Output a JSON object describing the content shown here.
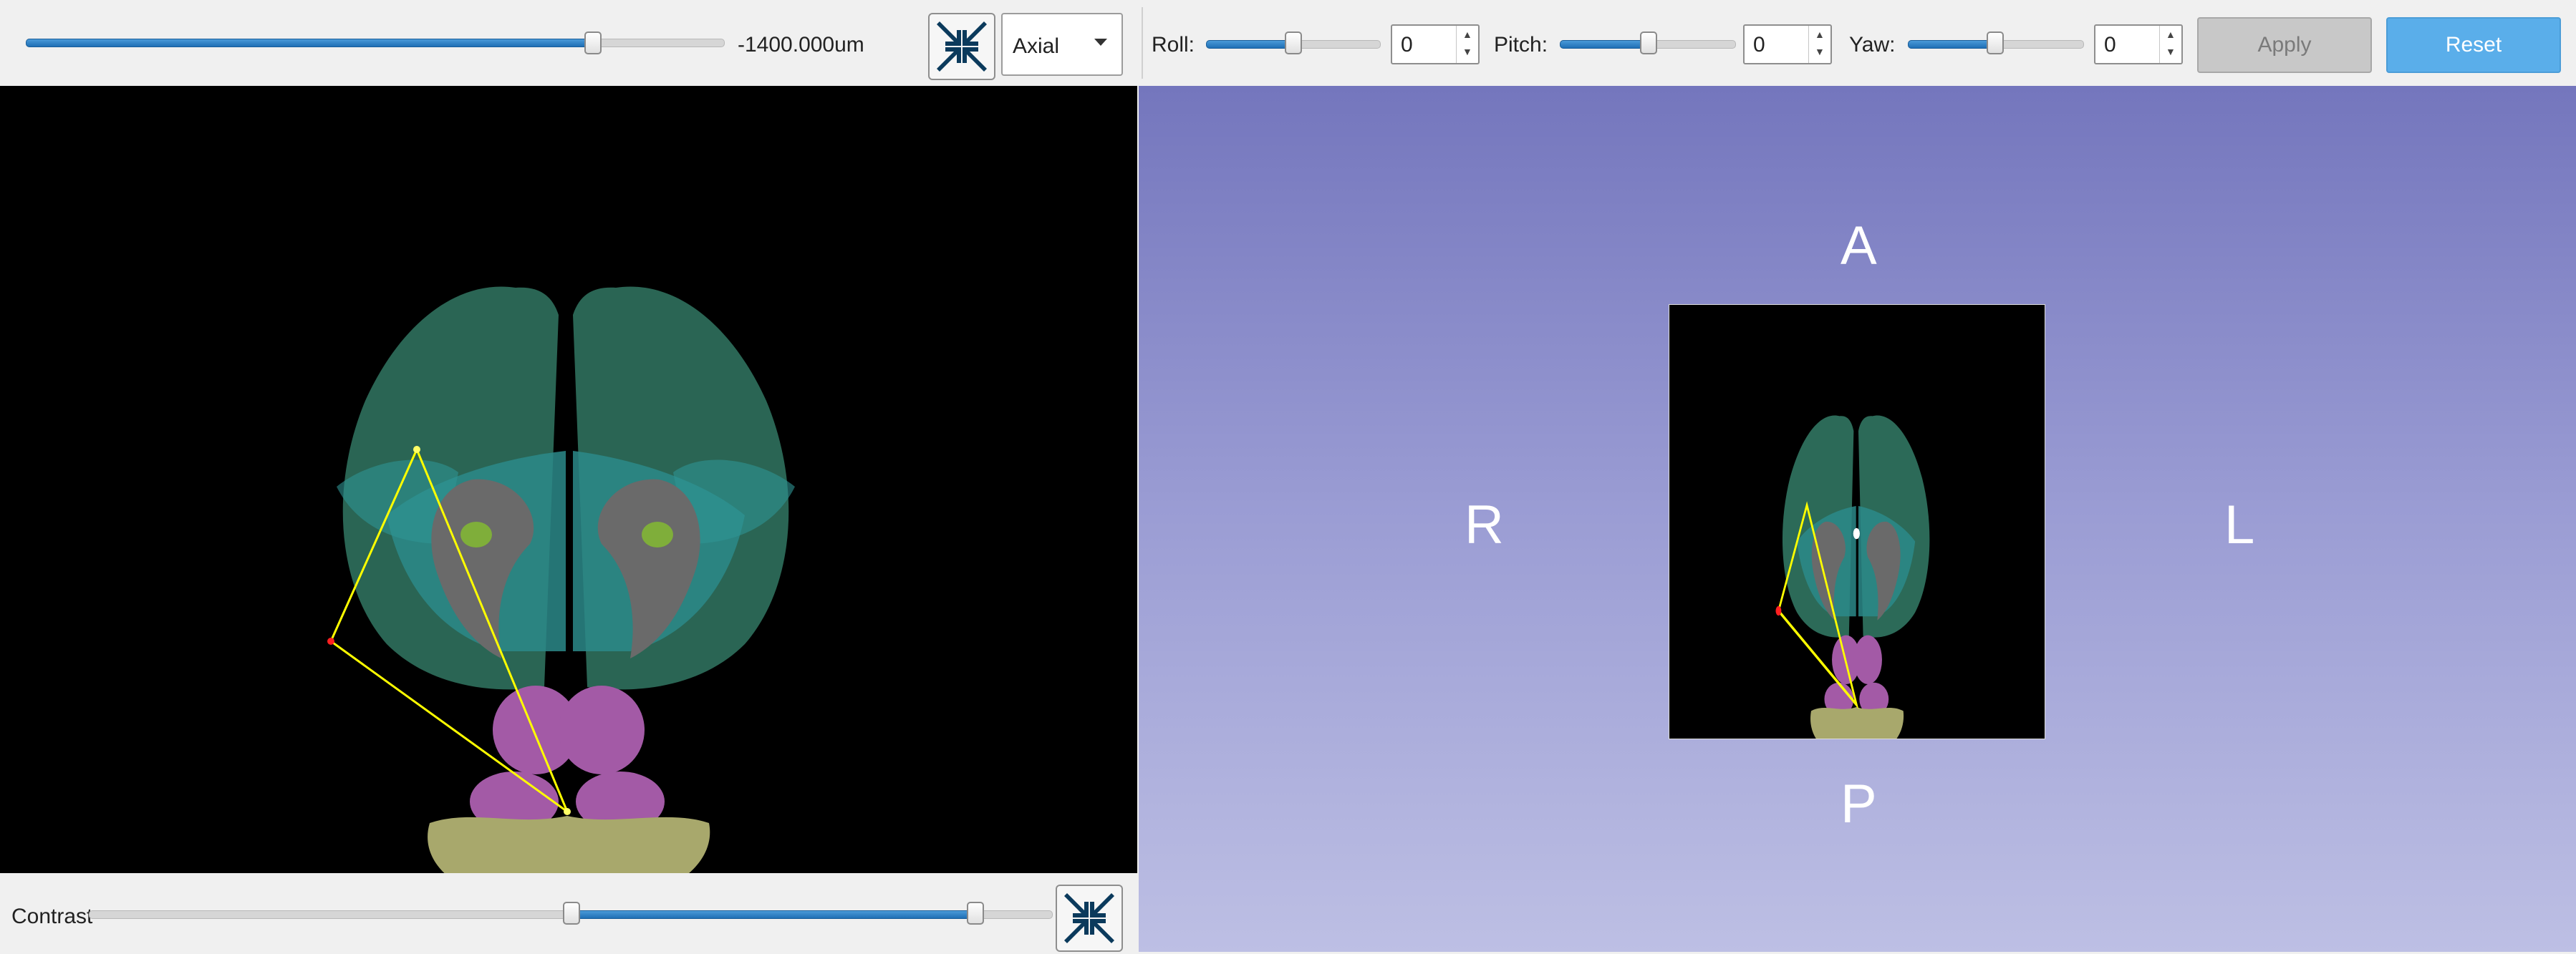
{
  "toolbar": {
    "slice_slider": {
      "value_fraction": 0.81,
      "readout": "-1400.000um"
    },
    "fit_button_icon": "fit-to-window-arrows-icon",
    "view_select": {
      "value": "Axial"
    },
    "roll": {
      "label": "Roll:",
      "value": "0",
      "slider_fraction": 0.5
    },
    "pitch": {
      "label": "Pitch:",
      "value": "0",
      "slider_fraction": 0.5
    },
    "yaw": {
      "label": "Yaw:",
      "value": "0",
      "slider_fraction": 0.5
    },
    "apply_label": "Apply",
    "reset_label": "Reset"
  },
  "view3d": {
    "orientation": {
      "anterior": "A",
      "posterior": "P",
      "right": "R",
      "left": "L"
    }
  },
  "bottom": {
    "contrast_label": "Contrast",
    "contrast_range": [
      0.49,
      0.92
    ],
    "fit_button_icon": "fit-to-window-arrows-icon"
  },
  "colors": {
    "accent": "#1f6fb5",
    "reset_button": "#5aaeea",
    "apply_button": "#c8c8c8",
    "view3d_top": "#7476bd",
    "view3d_bottom": "#bdbfe4",
    "annotation_line": "#ffff00",
    "annotation_point": "#ff2020"
  }
}
